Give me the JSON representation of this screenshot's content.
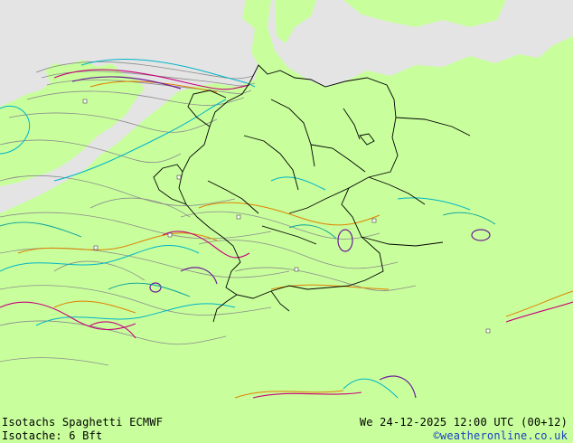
{
  "map": {
    "title": "Isotachs Spaghetti  ECMWF",
    "subtitle": "Isotache: 6 Bft",
    "valid_time": "We 24-12-2025 12:00 UTC (00+12)",
    "credit": "©weatheronline.co.uk",
    "colors": {
      "land": "#c8ff9c",
      "sea": "#e4e4e4",
      "border": "#000000",
      "contour_gray": "#808080",
      "contour_cyan": "#00b4c8",
      "contour_orange": "#e08000",
      "contour_magenta": "#c8007a",
      "contour_purple": "#6c1e96",
      "contour_teal": "#009c9c"
    }
  }
}
